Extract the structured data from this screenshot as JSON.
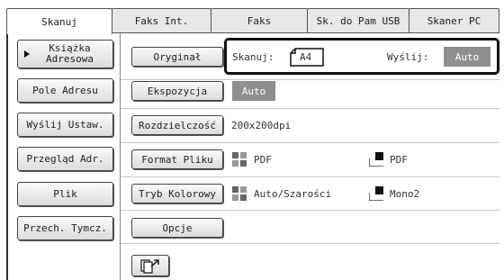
{
  "tabs": [
    {
      "label": "Skanuj",
      "active": true
    },
    {
      "label": "Faks Int.",
      "active": false
    },
    {
      "label": "Faks",
      "active": false
    },
    {
      "label": "Sk. do Pam USB",
      "active": false
    },
    {
      "label": "Skaner PC",
      "active": false
    }
  ],
  "sidebar": {
    "address_book_line1": "Książka",
    "address_book_line2": "Adresowa",
    "address_field": "Pole Adresu",
    "send_settings": "Wyślij Ustaw.",
    "address_review": "Przegląd Adr.",
    "file": "Plik",
    "quick_file": "Przech. Tymcz."
  },
  "original": {
    "button": "Oryginał",
    "scan_label": "Skanuj:",
    "scan_size": "A4",
    "send_label": "Wyślij:",
    "send_value": "Auto"
  },
  "exposure": {
    "button": "Ekspozycja",
    "value": "Auto"
  },
  "resolution": {
    "button": "Rozdzielczość",
    "value": "200x200dpi"
  },
  "file_format": {
    "button": "Format Pliku",
    "color_value": "PDF",
    "mono_value": "PDF"
  },
  "color_mode": {
    "button": "Tryb Kolorowy",
    "color_value": "Auto/Szarości",
    "mono_value": "Mono2"
  },
  "options": {
    "button": "Opcje"
  },
  "icons": {
    "arrow": "triangle-right-icon",
    "paper": "paper-a4-icon",
    "color_format": "color-grid-icon",
    "mono_format": "mono-page-icon",
    "bottom": "scan-send-icon"
  },
  "colors": {
    "accent_gray": "#8f8f8f",
    "border": "#111111"
  }
}
